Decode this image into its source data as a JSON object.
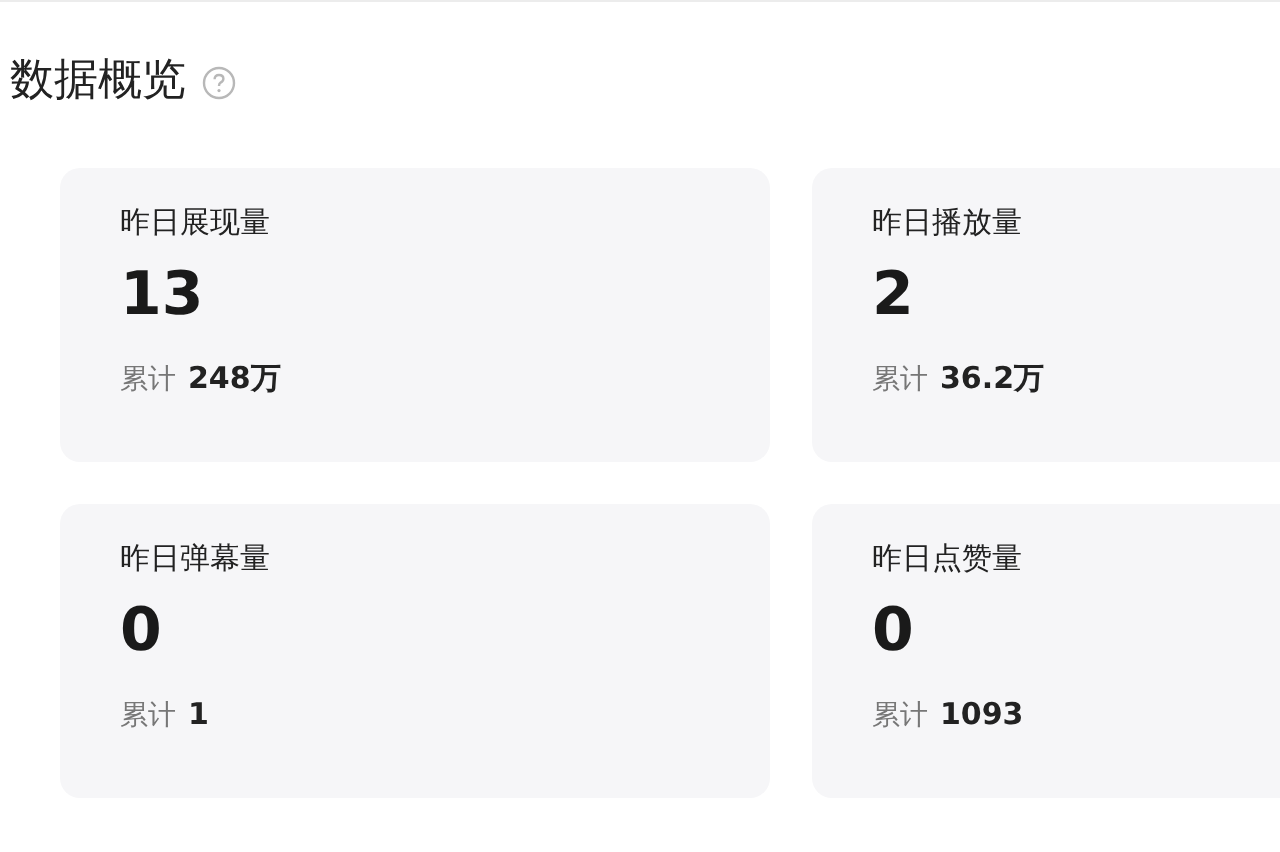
{
  "title": "数据概览",
  "cards": [
    {
      "label": "昨日展现量",
      "value": "13",
      "total_label": "累计",
      "total_value": "248万"
    },
    {
      "label": "昨日播放量",
      "value": "2",
      "total_label": "累计",
      "total_value": "36.2万"
    },
    {
      "label": "昨日弹幕量",
      "value": "0",
      "total_label": "累计",
      "total_value": "1"
    },
    {
      "label": "昨日点赞量",
      "value": "0",
      "total_label": "累计",
      "total_value": "1093"
    }
  ]
}
